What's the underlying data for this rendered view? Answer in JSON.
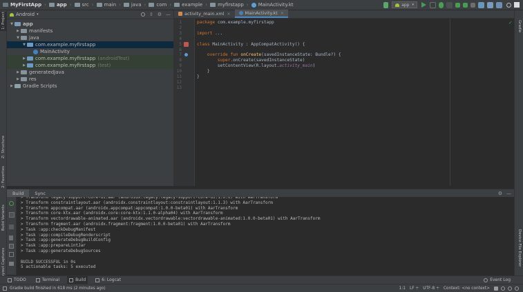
{
  "navbar": {
    "crumbs": [
      {
        "label": "MyFirstApp",
        "icon": "project-icon",
        "bold": true
      },
      {
        "label": "app",
        "icon": "module-folder-icon",
        "bold": true
      },
      {
        "label": "src",
        "icon": "folder-icon"
      },
      {
        "label": "main",
        "icon": "folder-icon"
      },
      {
        "label": "java",
        "icon": "folder-icon"
      },
      {
        "label": "com",
        "icon": "folder-icon"
      },
      {
        "label": "example",
        "icon": "folder-icon"
      },
      {
        "label": "myfirstapp",
        "icon": "folder-icon"
      },
      {
        "label": "MainActivity.kt",
        "icon": "kotlin-file-icon"
      }
    ],
    "run_config": "app"
  },
  "left_stripe": {
    "project_label": "1: Project",
    "structure_label": "Z: Structure",
    "favorites_label": "2: Favorites",
    "build_variants_label": "Build Variants",
    "layout_captures_label": "Layout Captures"
  },
  "right_stripe": {
    "gradle_label": "Gradle",
    "device_explorer_label": "Device File Explorer"
  },
  "project_panel": {
    "view_mode": "Android",
    "tree": [
      {
        "label": "app",
        "depth": 0,
        "expanded": true,
        "icon": "module-folder-icon",
        "bold": true
      },
      {
        "label": "manifests",
        "depth": 1,
        "expanded": false,
        "icon": "folder-icon"
      },
      {
        "label": "java",
        "depth": 1,
        "expanded": true,
        "icon": "folder-icon"
      },
      {
        "label": "com.example.myfirstapp",
        "depth": 2,
        "expanded": true,
        "icon": "package-icon",
        "selected": true
      },
      {
        "label": "MainActivity",
        "depth": 3,
        "icon": "kotlin-class-icon"
      },
      {
        "label": "com.example.myfirstapp",
        "suffix": "(androidTest)",
        "depth": 2,
        "expanded": false,
        "icon": "package-icon",
        "highlight": true
      },
      {
        "label": "com.example.myfirstapp",
        "suffix": "(test)",
        "depth": 2,
        "expanded": false,
        "icon": "package-icon",
        "highlight": true
      },
      {
        "label": "generatedJava",
        "depth": 1,
        "expanded": false,
        "icon": "folder-icon"
      },
      {
        "label": "res",
        "depth": 1,
        "expanded": false,
        "icon": "folder-icon"
      },
      {
        "label": "Gradle Scripts",
        "depth": 0,
        "expanded": false,
        "icon": "gradle-icon"
      }
    ]
  },
  "editor": {
    "tabs": [
      {
        "label": "activity_main.xml",
        "icon": "xml-file-icon",
        "active": false
      },
      {
        "label": "MainActivity.kt",
        "icon": "kotlin-file-icon",
        "active": true
      }
    ],
    "line_numbers": [
      "1",
      "2",
      "3",
      "4",
      "5",
      "6",
      "7",
      "8",
      "9",
      "10",
      "11",
      "12",
      "13"
    ],
    "lines": [
      [
        {
          "t": "package ",
          "c": "kw"
        },
        {
          "t": "com.example.myfirstapp",
          "c": "pl"
        }
      ],
      [],
      [
        {
          "t": "import ",
          "c": "kw"
        },
        {
          "t": "...",
          "c": "pl"
        }
      ],
      [],
      [
        {
          "t": "class ",
          "c": "kw"
        },
        {
          "t": "MainActivity : AppCompatActivity() {",
          "c": "pl"
        }
      ],
      [],
      [
        {
          "t": "    override fun ",
          "c": "kw"
        },
        {
          "t": "onCreate",
          "c": "fn"
        },
        {
          "t": "(savedInstanceState: Bundle?) {",
          "c": "pl"
        }
      ],
      [
        {
          "t": "        super",
          "c": "kw"
        },
        {
          "t": ".onCreate(savedInstanceState)",
          "c": "pl"
        }
      ],
      [
        {
          "t": "        setContentView(R.layout.",
          "c": "pl"
        },
        {
          "t": "activity_main",
          "c": "pu"
        },
        {
          "t": ")",
          "c": "pl"
        }
      ],
      [
        {
          "t": "    }",
          "c": "pl"
        }
      ],
      [
        {
          "t": "}",
          "c": "pl"
        }
      ],
      [],
      []
    ]
  },
  "build_panel": {
    "tabs": [
      "Build",
      "Sync"
    ],
    "active_tab": "Build",
    "output": [
      "> Transform legacy-support-core-ui.aar (androidx.legacy:legacy-support-core-ui:1.0.0) with AarTransform",
      "> Transform constraintlayout.aar (androidx.constraintlayout:constraintlayout:1.1.3) with AarTransform",
      "> Transform appcompat.aar (androidx.appcompat:appcompat:1.0.0-beta01) with AarTransform",
      "> Transform core-ktx.aar (androidx.core:core-ktx:1.1.0-alpha04) with AarTransform",
      "> Transform vectordrawable-animated.aar (androidx.vectordrawable:vectordrawable-animated:1.0.0-beta01) with AarTransform",
      "> Transform fragment.aar (androidx.fragment:fragment:1.0.0-beta01) with AarTransform",
      "> Task :app:checkDebugManifest",
      "> Task :app:compileDebugRenderscript",
      "> Task :app:generateDebugBuildConfig",
      "> Task :app:prepareLintJar",
      "> Task :app:generateDebugSources",
      "",
      "BUILD SUCCESSFUL in 0s",
      "5 actionable tasks: 5 executed"
    ]
  },
  "tool_windows": [
    {
      "label": "TODO",
      "icon": "todo-icon"
    },
    {
      "label": "Terminal",
      "icon": "terminal-icon"
    },
    {
      "label": "Build",
      "icon": "build-icon",
      "active": true
    },
    {
      "label": "6: Logcat",
      "icon": "logcat-icon"
    }
  ],
  "event_log_label": "Event Log",
  "status": {
    "message": "Gradle build finished in 618 ms (2 minutes ago)",
    "position": "1:1",
    "line_sep": "LF ÷",
    "encoding": "UTF-8 ÷",
    "context": "Context: <no context>"
  },
  "colors": {
    "run_green": "#499c54",
    "accent_blue": "#4a88c7",
    "keyword": "#cc7832",
    "function": "#ffc66d",
    "property": "#9876aa"
  }
}
